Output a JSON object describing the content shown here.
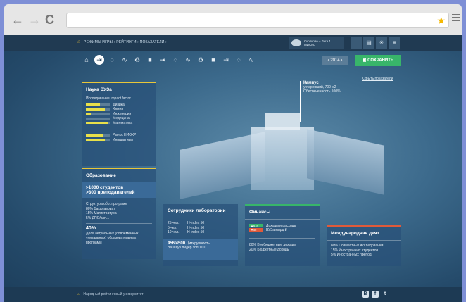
{
  "browser": {
    "back": "←",
    "forward": "→",
    "reload": "C",
    "star": "★"
  },
  "app": {
    "breadcrumb": "РЕЖИМЫ ИГРЫ › РЕЙТИНГИ › ПОКАЗАТЕЛИ ›",
    "team": {
      "line1": "Сколково – Лига 1",
      "line2": "МИСиС"
    },
    "year_label": "‹ 2014 ›",
    "save_label": "СОХРАНИТЬ",
    "hide_indicators": "Скрыть показатели",
    "campus": {
      "title": "Кампус",
      "line1": "устаревший, 700 м2",
      "line2": "Обеспеченность 100%"
    },
    "science": {
      "title": "Наука ВУЗа",
      "subtitle": "Исследование Impact factor",
      "items": [
        "Физика",
        "Химия",
        "Инженерия",
        "Медицина",
        "Математика"
      ],
      "fills": [
        0.6,
        0.8,
        0.2,
        0.0,
        0.9
      ],
      "items2": [
        "Рынок НИОКР",
        "Инициативы"
      ],
      "fills2": [
        0.7,
        0.8
      ]
    },
    "education": {
      "title": "Образование",
      "line1": ">1000 студентов",
      "line2": ">300 преподавателей",
      "struct_title": "Структура обр. программ",
      "struct1": "80% Бакалавриат",
      "struct2": "15% Магистратура",
      "struct3": "5% ДПО/асп...",
      "pct": "40%",
      "pct_desc1": "Доля актуальных (современных,",
      "pct_desc2": "уникальных) образовательных",
      "pct_desc3": "программ"
    },
    "lab": {
      "title": "Сотрудники лаборатории",
      "rows": [
        {
          "a": "25 чел.",
          "b": "H-index 50"
        },
        {
          "a": "5 чел.",
          "b": "H-index 50"
        },
        {
          "a": "10 чел.",
          "b": "H-index 50"
        }
      ],
      "cite_num": "456/4500",
      "cite_text": "Цитируемость",
      "cite_line2": "Ваш вуз лидер топ 100"
    },
    "finance": {
      "title": "Финансы",
      "badge_up": "▲678",
      "badge_down": "▼56",
      "line1": "Доходы и расходы",
      "line2": "ВУЗа млрд ₽",
      "b1": "80% Внебюджетные доходы",
      "b2": "20% Бюджетные доходы"
    },
    "intl": {
      "title": "Международная деят.",
      "l1": "80% Совместных исследований",
      "l2": "15% Иностранных студентов",
      "l3": "5% Иностранных препод."
    },
    "footer": "Народный рейтинговый университет",
    "social": [
      "В",
      "f",
      "t"
    ]
  }
}
